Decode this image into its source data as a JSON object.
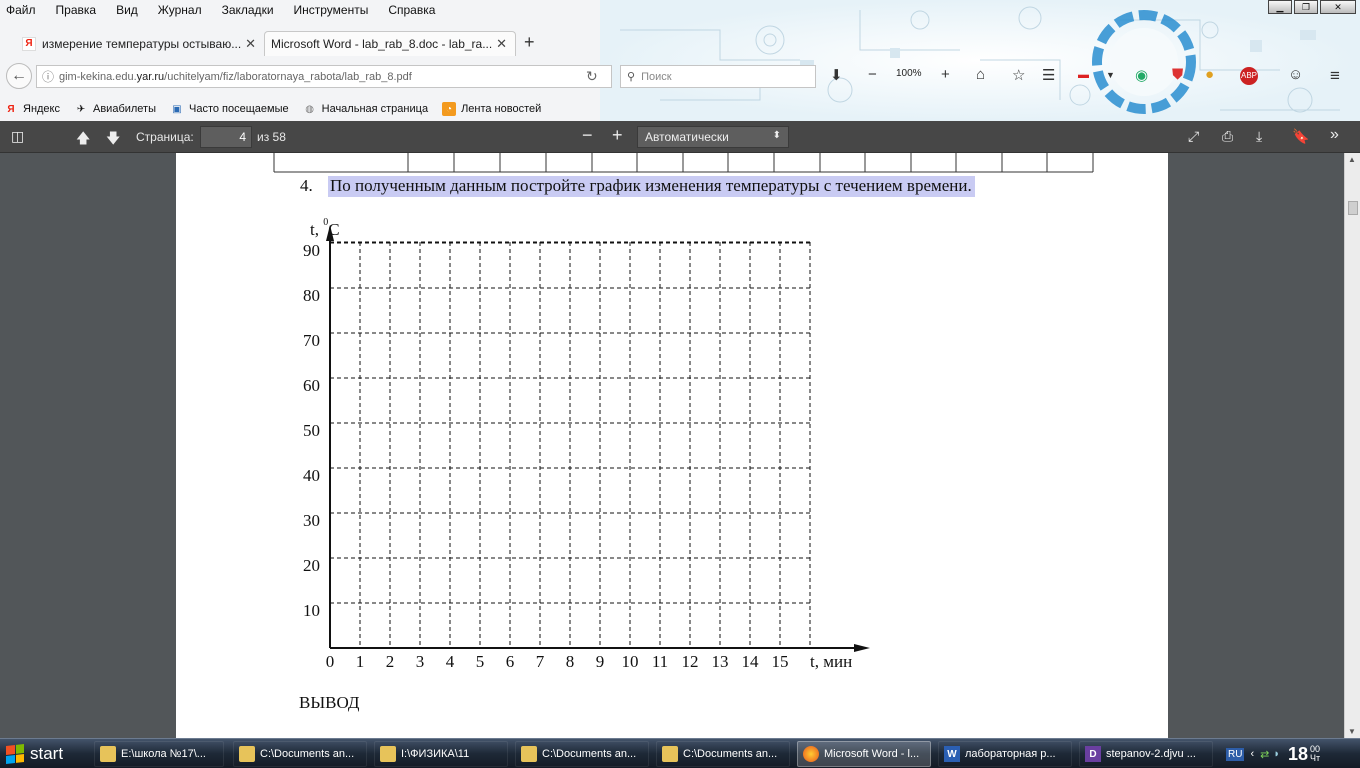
{
  "menubar": {
    "items": [
      "Файл",
      "Правка",
      "Вид",
      "Журнал",
      "Закладки",
      "Инструменты",
      "Справка"
    ]
  },
  "tabs": [
    {
      "label": "измерение температуры остываю...",
      "favicon": "yandex-icon",
      "active": false
    },
    {
      "label": "Microsoft Word - lab_rab_8.doc - lab_ra...",
      "favicon": "none",
      "active": true
    }
  ],
  "navbar": {
    "url_prefix": "gim-kekina.edu.",
    "url_host": "yar.ru",
    "url_path": "/uchitelyam/fiz/laboratornaya_rabota/lab_rab_8.pdf",
    "search_placeholder": "Поиск",
    "zoom": "100%"
  },
  "bookmarks": [
    {
      "label": "Яндекс",
      "icon": "yandex-icon"
    },
    {
      "label": "Авиабилеты",
      "icon": "plane-icon"
    },
    {
      "label": "Часто посещаемые",
      "icon": "folder-search-icon"
    },
    {
      "label": "Начальная страница",
      "icon": "globe-icon"
    },
    {
      "label": "Лента новостей",
      "icon": "rss-icon"
    }
  ],
  "pdf_toolbar": {
    "page_label": "Страница:",
    "page_value": "4",
    "page_total": "из 58",
    "zoom_value": "Автоматически"
  },
  "document": {
    "task_number": "4.",
    "task_text": "По полученным данным постройте график изменения температуры с течением времени.",
    "conclusion": "ВЫВОД"
  },
  "chart_data": {
    "type": "line",
    "title": "",
    "series": [],
    "xlabel": "t, мин",
    "ylabel_prefix": "t, ",
    "ylabel_sup": "0",
    "ylabel_unit": "С",
    "x_ticks": [
      "0",
      "1",
      "2",
      "3",
      "4",
      "5",
      "6",
      "7",
      "8",
      "9",
      "10",
      "11",
      "12",
      "13",
      "14",
      "15"
    ],
    "y_ticks": [
      "10",
      "20",
      "30",
      "40",
      "50",
      "60",
      "70",
      "80",
      "90"
    ],
    "xlim": [
      0,
      16
    ],
    "ylim": [
      0,
      90
    ],
    "grid": true,
    "grid_style": "dashed"
  },
  "taskbar": {
    "start_label": "start",
    "items": [
      {
        "label": "E:\\школа №17\\...",
        "icon": "folder-icon"
      },
      {
        "label": "C:\\Documents an...",
        "icon": "folder-icon"
      },
      {
        "label": "I:\\ФИЗИКА\\11",
        "icon": "folder-icon"
      },
      {
        "label": "C:\\Documents an...",
        "icon": "folder-icon"
      },
      {
        "label": "C:\\Documents an...",
        "icon": "folder-icon"
      },
      {
        "label": "Microsoft Word - l...",
        "icon": "firefox-icon"
      },
      {
        "label": "лабораторная р...",
        "icon": "word-icon"
      },
      {
        "label": "stepanov-2.djvu ...",
        "icon": "djvu-icon"
      }
    ],
    "tray": {
      "lang": "RU",
      "time_hour": "18",
      "time_min": "00",
      "day": "Чт"
    }
  },
  "colors": {
    "pdf_toolbar_bg": "#474747",
    "viewer_bg": "#525659",
    "highlight": "#c9cbf3",
    "taskbar_bg": "#1e2937"
  }
}
